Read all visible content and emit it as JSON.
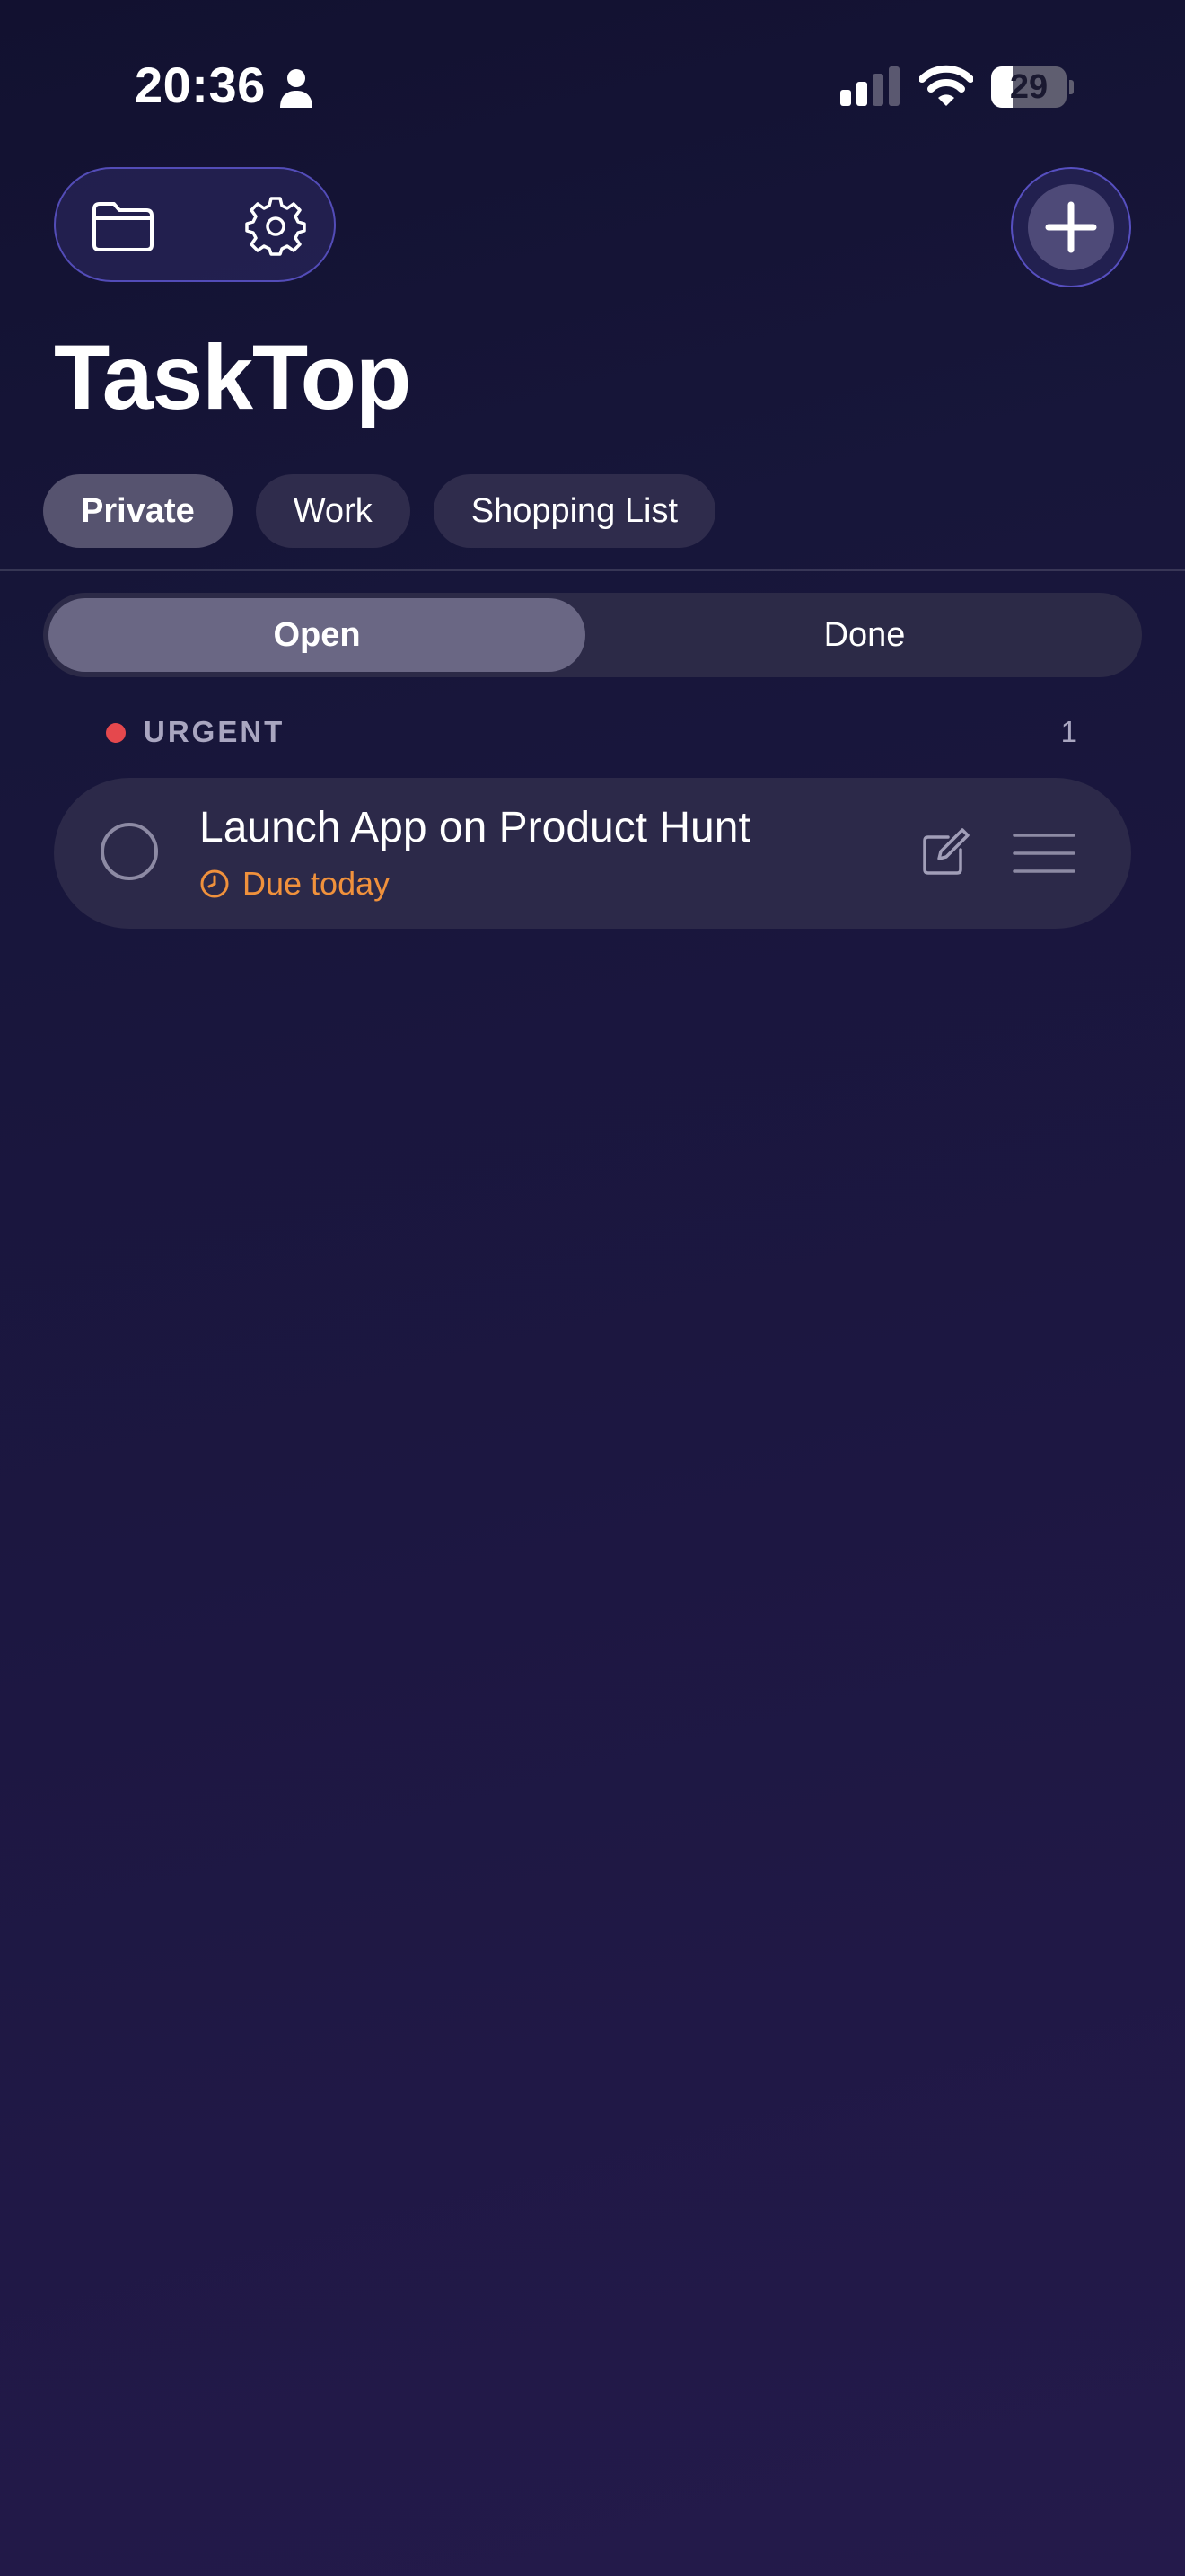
{
  "status_bar": {
    "time": "20:36",
    "battery_level": "29",
    "battery_fraction": 0.29,
    "icons": [
      "person-icon",
      "cellular-signal-icon",
      "wifi-icon",
      "battery-icon"
    ]
  },
  "toolbar": {
    "icons": [
      "folder-icon",
      "gear-icon",
      "plus-icon"
    ]
  },
  "app": {
    "title": "TaskTop"
  },
  "list_tabs": [
    {
      "label": "Private",
      "active": true
    },
    {
      "label": "Work",
      "active": false
    },
    {
      "label": "Shopping List",
      "active": false
    }
  ],
  "segmented": {
    "open_label": "Open",
    "done_label": "Done",
    "selected": "Open"
  },
  "section": {
    "title": "URGENT",
    "count": "1",
    "dot_color": "#e5484d"
  },
  "tasks": [
    {
      "title": "Launch App on Product Hunt",
      "due": "Due today",
      "due_color": "#f0913c"
    }
  ],
  "colors": {
    "accent_outline": "#645cdc",
    "card_background": "#2c2949"
  }
}
